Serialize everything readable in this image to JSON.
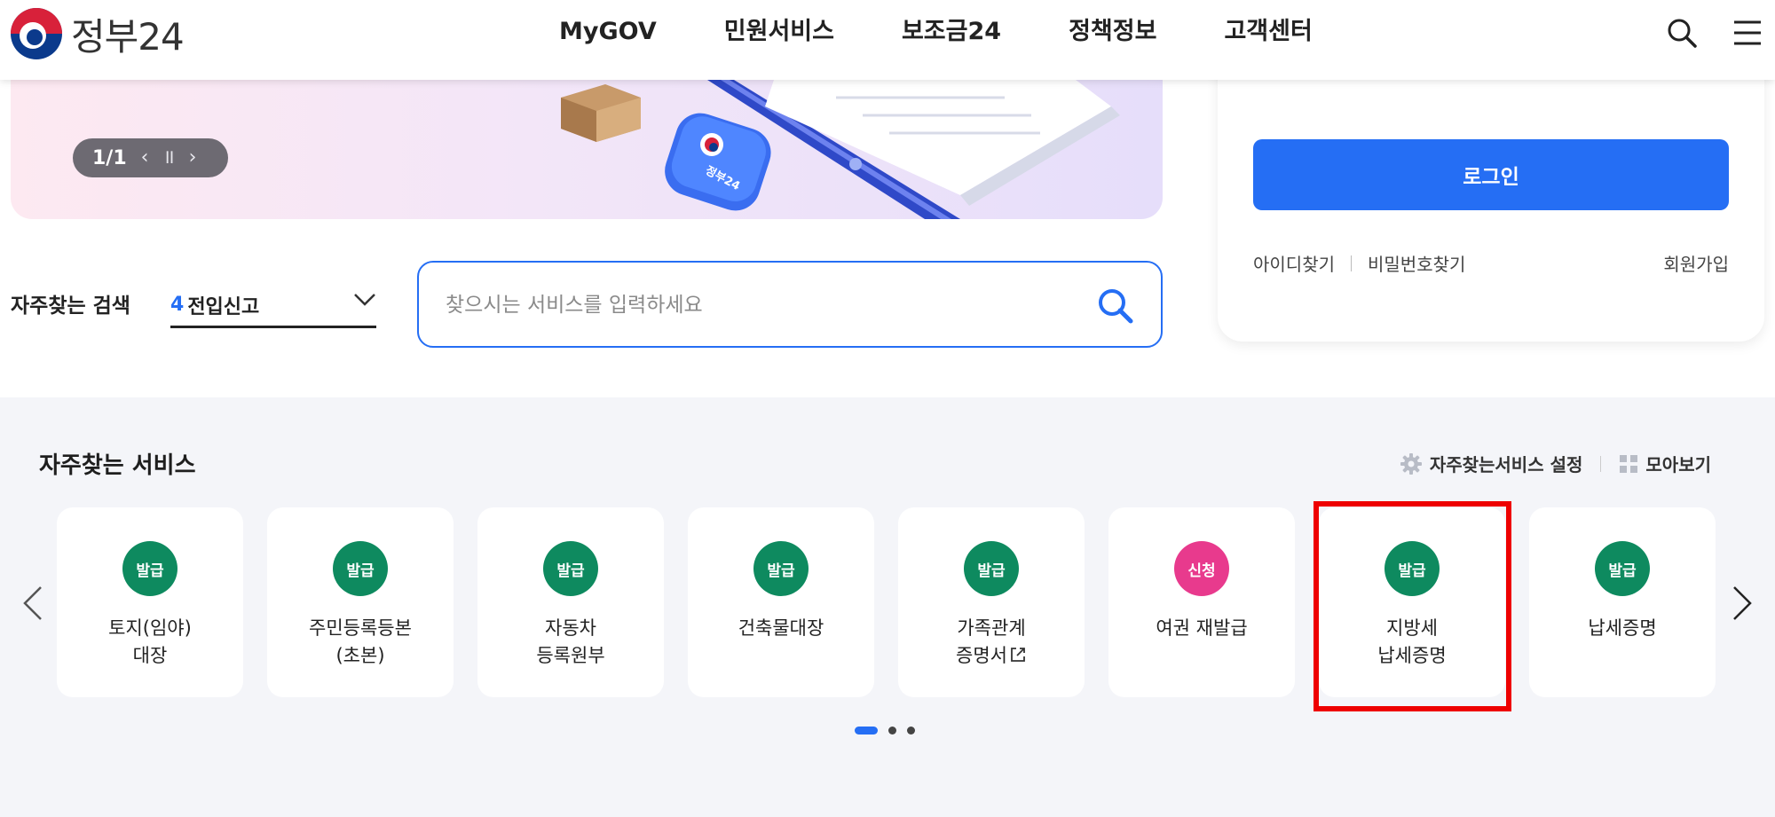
{
  "header": {
    "logo_text": "정부24",
    "nav": [
      "MyGOV",
      "민원서비스",
      "보조금24",
      "정책정보",
      "고객센터"
    ]
  },
  "banner": {
    "badge_text": "정부24",
    "slide_counter": "1/1"
  },
  "frequent_search": {
    "label": "자주찾는 검색",
    "selected_number": "4",
    "selected_text": "전입신고",
    "search_placeholder": "찾으시는 서비스를 입력하세요"
  },
  "login": {
    "button": "로그인",
    "find_id": "아이디찾기",
    "find_password": "비밀번호찾기",
    "join": "회원가입"
  },
  "services": {
    "title": "자주찾는 서비스",
    "settings_label": "자주찾는서비스 설정",
    "view_all_label": "모아보기",
    "items": [
      {
        "badge": "발급",
        "line1": "토지(임야)",
        "line2": "대장"
      },
      {
        "badge": "발급",
        "line1": "주민등록등본",
        "line2": "(초본)"
      },
      {
        "badge": "발급",
        "line1": "자동차",
        "line2": "등록원부"
      },
      {
        "badge": "발급",
        "line1": "건축물대장",
        "line2": ""
      },
      {
        "badge": "발급",
        "line1": "가족관계",
        "line2": "증명서"
      },
      {
        "badge": "신청",
        "line1": "여권 재발급",
        "line2": ""
      },
      {
        "badge": "발급",
        "line1": "지방세",
        "line2": "납세증명"
      },
      {
        "badge": "발급",
        "line1": "납세증명",
        "line2": ""
      }
    ],
    "page_dots": 3,
    "active_dot": 1
  },
  "colors": {
    "primary": "#256ef4",
    "issue_badge": "#0e8a5f",
    "apply_badge": "#e83a8d",
    "highlight": "#ee0000",
    "section_bg": "#f4f5f9"
  }
}
